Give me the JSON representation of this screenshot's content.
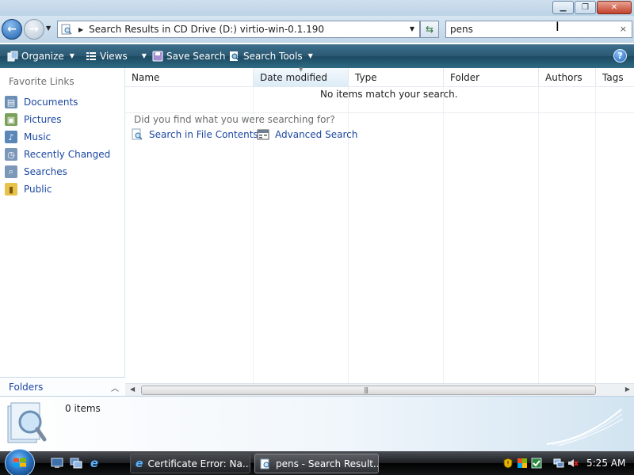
{
  "address": {
    "path": "Search Results in CD Drive (D:) virtio-win-0.1.190"
  },
  "search": {
    "value": "pens",
    "clear_label": "×"
  },
  "toolbar": {
    "organize": "Organize",
    "views": "Views",
    "save_search": "Save Search",
    "search_tools": "Search Tools",
    "help": "?"
  },
  "nav": {
    "favorite_links_title": "Favorite Links",
    "items": [
      {
        "label": "Documents",
        "icon": "documents-icon"
      },
      {
        "label": "Pictures",
        "icon": "pictures-icon"
      },
      {
        "label": "Music",
        "icon": "music-icon"
      },
      {
        "label": "Recently Changed",
        "icon": "recently-changed-icon"
      },
      {
        "label": "Searches",
        "icon": "searches-icon"
      },
      {
        "label": "Public",
        "icon": "public-folder-icon"
      }
    ],
    "folders_label": "Folders"
  },
  "columns": [
    "Name",
    "Date modified",
    "Type",
    "Folder",
    "Authors",
    "Tags"
  ],
  "results": {
    "empty_message": "No items match your search.",
    "prompt": "Did you find what you were searching for?",
    "search_in_contents": "Search in File Contents",
    "advanced_search": "Advanced Search"
  },
  "details": {
    "item_count": "0 items"
  },
  "taskbar": {
    "tasks": [
      {
        "label": "Certificate Error: Na...",
        "icon": "internet-explorer-icon",
        "active": false
      },
      {
        "label": "pens - Search Result...",
        "icon": "search-folder-icon",
        "active": true
      }
    ],
    "clock": "5:25 AM"
  },
  "colors": {
    "link": "#1c47a1",
    "cmdbar": "#2b5973",
    "taskbar": "#1b1d21"
  }
}
